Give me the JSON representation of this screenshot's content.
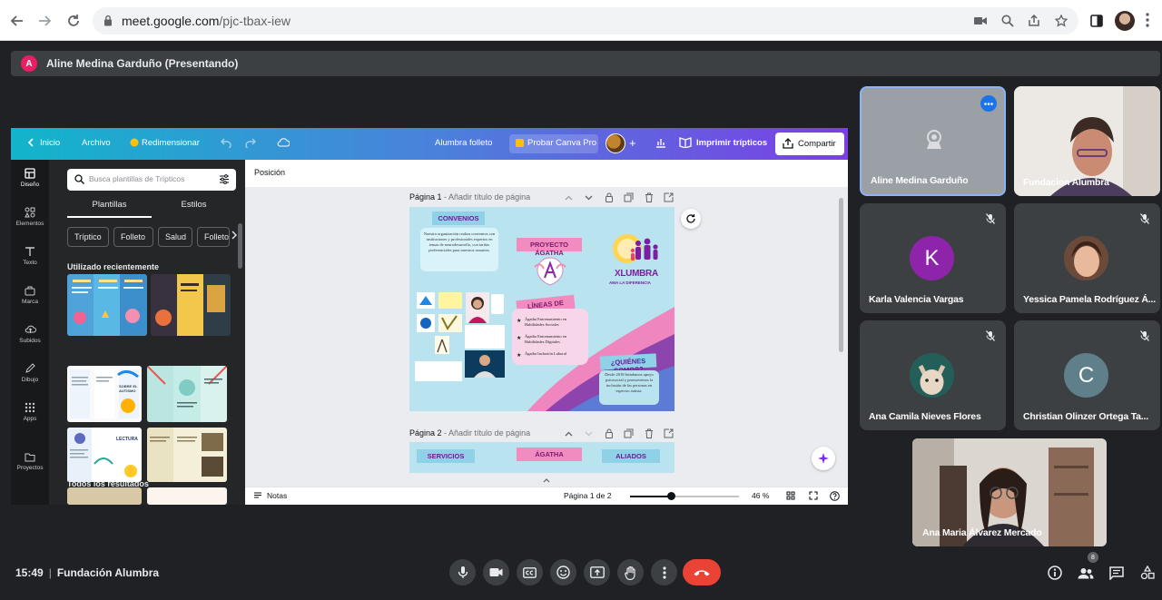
{
  "browser": {
    "url_host": "meet.google.com",
    "url_path": "/pjc-tbax-iew"
  },
  "presenting_bar": {
    "avatar_letter": "A",
    "text": "Aline Medina Garduño (Presentando)"
  },
  "canva": {
    "topbar": {
      "home": "Inicio",
      "file": "Archivo",
      "resize": "Redimensionar",
      "doc_title": "Alumbra folleto",
      "try_pro": "Probar Canva Pro",
      "print": "Imprimir trípticos",
      "share": "Compartir"
    },
    "rail": [
      "Diseño",
      "Elementos",
      "Texto",
      "Marca",
      "Subidos",
      "Dibujo",
      "Apps",
      "Proyectos"
    ],
    "panel": {
      "search_placeholder": "Busca plantillas de Trípticos",
      "tabs": [
        "Plantillas",
        "Estilos"
      ],
      "chips": [
        "Tríptico",
        "Folleto",
        "Salud",
        "Folleto"
      ],
      "recent_title": "Utilizado recientemente",
      "all_results_title": "Todos los resultados",
      "thumb_texts": [
        "SOBRE EL AUTISMO",
        "LECTURA"
      ]
    },
    "workarea": {
      "position_label": "Posición",
      "page1_label": "Página 1",
      "page1_sub": " - Añadir título de página",
      "page2_label": "Página 2",
      "page2_sub": " - Añadir título de página"
    },
    "design": {
      "convenios": "CONVENIOS",
      "convenios_text": "Nuestra organización realiza convenios con instituciones y profesionales expertos en temas de neurodesarrollo, con tarifas preferenciales para nuestros usuarios.",
      "proyecto": "PROYECTO ÁGATHA",
      "brand": "LUMBRA",
      "brand_x": "X",
      "brand_tagline": "AMA LA DIFERENCIA",
      "lineas": "LÍNEAS DE TRABAJO",
      "bullets": [
        "Ágatha Entrenamiento en Habilidades Sociales",
        "Ágatha Entrenamiento en Habilidades Digitales",
        "Ágatha Inclusión Laboral"
      ],
      "quienes": "¿QUIÉNES SOMOS?",
      "quienes_text": "Desde 2018 brindamos apoyo psicosocial y promovemos la inclusión de las personas en espectro autista.",
      "page2_ribbons": [
        "SERVICIOS",
        "ÁGATHA",
        "ALIADOS"
      ]
    },
    "bottombar": {
      "notes": "Notas",
      "pages": "Página 1 de 2",
      "zoom": "46 %",
      "zoom_fraction": 0.38
    }
  },
  "participants": [
    {
      "name": "Aline Medina Garduño",
      "selected": true
    },
    {
      "name": "Fundacion Alumbra"
    },
    {
      "name": "Karla Valencia Vargas",
      "letter": "K",
      "color": "#8e24aa"
    },
    {
      "name": "Yessica Pamela Rodríguez Á..."
    },
    {
      "name": "Ana Camila Nieves Flores"
    },
    {
      "name": "Christian Olinzer Ortega Ta...",
      "letter": "C",
      "color": "#5f7f8a"
    },
    {
      "name": "Ana Maria Álvarez Mercado"
    }
  ],
  "meeting": {
    "time": "15:49",
    "separator": "|",
    "name": "Fundación Alumbra",
    "participant_count": "8"
  },
  "colors": {
    "end_call": "#ea4335",
    "canva_gradient_start": "#12b5cb",
    "canva_gradient_end": "#7b3fe4"
  }
}
